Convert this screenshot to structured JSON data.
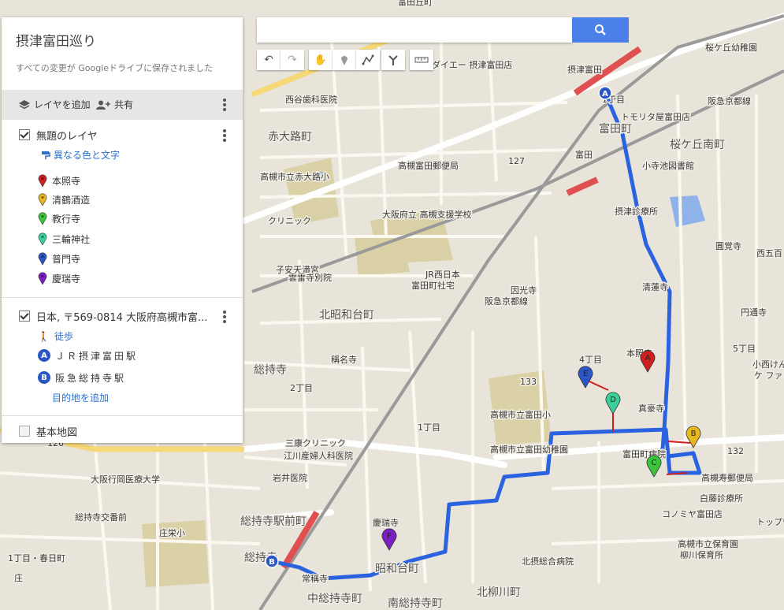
{
  "panel": {
    "title": "摂津富田巡り",
    "saved_status": "すべての変更が Googleドライブに保存されました",
    "add_layer": "レイヤを追加",
    "share": "共有",
    "layer1": {
      "name": "無題のレイヤ",
      "style_link": "異なる色と文字",
      "items": [
        {
          "label": "本照寺",
          "color": "#d01f1f"
        },
        {
          "label": "清鶴酒造",
          "color": "#e8b820"
        },
        {
          "label": "教行寺",
          "color": "#3cc43c"
        },
        {
          "label": "三輪神社",
          "color": "#3ad09a"
        },
        {
          "label": "普門寺",
          "color": "#2a56c6"
        },
        {
          "label": "慶瑞寺",
          "color": "#7b1fc4"
        }
      ]
    },
    "layer2": {
      "name": "日本, 〒569-0814 大阪府高槻市富...",
      "mode": "徒歩",
      "point_a_badge": "A",
      "point_a": "ＪＲ摂津富田駅",
      "point_b_badge": "B",
      "point_b": "阪急総持寺駅",
      "add_destination": "目的地を追加"
    },
    "basemap": "基本地図"
  },
  "search": {
    "placeholder": ""
  },
  "colors": {
    "route": "#2a62e0",
    "search_button": "#4a80e8"
  },
  "map": {
    "labels": [
      {
        "text": "富田丘町"
      },
      {
        "text": "赤大路"
      },
      {
        "text": "西谷歯科医院"
      },
      {
        "text": "ダイエー 摂津富田店"
      },
      {
        "text": "桜ケ丘幼稚園"
      },
      {
        "text": "摂津富田"
      },
      {
        "text": "1丁目"
      },
      {
        "text": "富田町"
      },
      {
        "text": "トモリタ屋富田店"
      },
      {
        "text": "阪急京都線"
      },
      {
        "text": "桜ケ丘南町"
      },
      {
        "text": "赤大路町"
      },
      {
        "text": "高槻富田郵便局"
      },
      {
        "text": "高槻市立赤大路小"
      },
      {
        "text": "富田"
      },
      {
        "text": "小寺池図書館"
      },
      {
        "text": "大阪府立 高槻支援学校"
      },
      {
        "text": "摂津診療所"
      },
      {
        "text": "クリニック"
      },
      {
        "text": "子安天満宮"
      },
      {
        "text": "雲雷寺別院"
      },
      {
        "text": "JR西日本"
      },
      {
        "text": "富田町社宅"
      },
      {
        "text": "阪急京都線"
      },
      {
        "text": "圓覚寺"
      },
      {
        "text": "西五百"
      },
      {
        "text": "因光寺"
      },
      {
        "text": "清蓮寺"
      },
      {
        "text": "北昭和台町"
      },
      {
        "text": "円通寺"
      },
      {
        "text": "4丁目"
      },
      {
        "text": "本照寺"
      },
      {
        "text": "5丁目"
      },
      {
        "text": "総持寺"
      },
      {
        "text": "稱名寺"
      },
      {
        "text": "小西けん"
      },
      {
        "text": "ケ ファミ"
      },
      {
        "text": "2丁目"
      },
      {
        "text": "真豪寺"
      },
      {
        "text": "高槻市立富田小"
      },
      {
        "text": "1丁目"
      },
      {
        "text": "三康クリニック"
      },
      {
        "text": "江川産婦人科医院"
      },
      {
        "text": "高槻市立富田幼稚園"
      },
      {
        "text": "富田町病院"
      },
      {
        "text": "大阪行岡医療大学"
      },
      {
        "text": "岩井医院"
      },
      {
        "text": "高槻寿郵便局"
      },
      {
        "text": "白藤診療所"
      },
      {
        "text": "総持寺交番前"
      },
      {
        "text": "コノミヤ富田店"
      },
      {
        "text": "トップワ"
      },
      {
        "text": "総持寺駅前町"
      },
      {
        "text": "慶瑞寺"
      },
      {
        "text": "庄栄小"
      },
      {
        "text": "高槻市立保育園"
      },
      {
        "text": "柳川保育所"
      },
      {
        "text": "1丁目・春日町"
      },
      {
        "text": "北摂総合病院"
      },
      {
        "text": "総持寺"
      },
      {
        "text": "常稱寺"
      },
      {
        "text": "昭和台町"
      },
      {
        "text": "北柳川町"
      },
      {
        "text": "中総持寺町"
      },
      {
        "text": "南総持寺町"
      },
      {
        "text": "庄"
      },
      {
        "text": "127"
      },
      {
        "text": "133"
      },
      {
        "text": "132"
      },
      {
        "text": "126"
      }
    ],
    "markers": [
      {
        "letter": "A",
        "color": "#d01f1f"
      },
      {
        "letter": "B",
        "color": "#e8b820"
      },
      {
        "letter": "C",
        "color": "#3cc43c"
      },
      {
        "letter": "D",
        "color": "#3ad09a"
      },
      {
        "letter": "E",
        "color": "#2a56c6"
      },
      {
        "letter": "F",
        "color": "#7b1fc4"
      }
    ],
    "route_ends": [
      {
        "letter": "A"
      },
      {
        "letter": "B"
      }
    ]
  }
}
